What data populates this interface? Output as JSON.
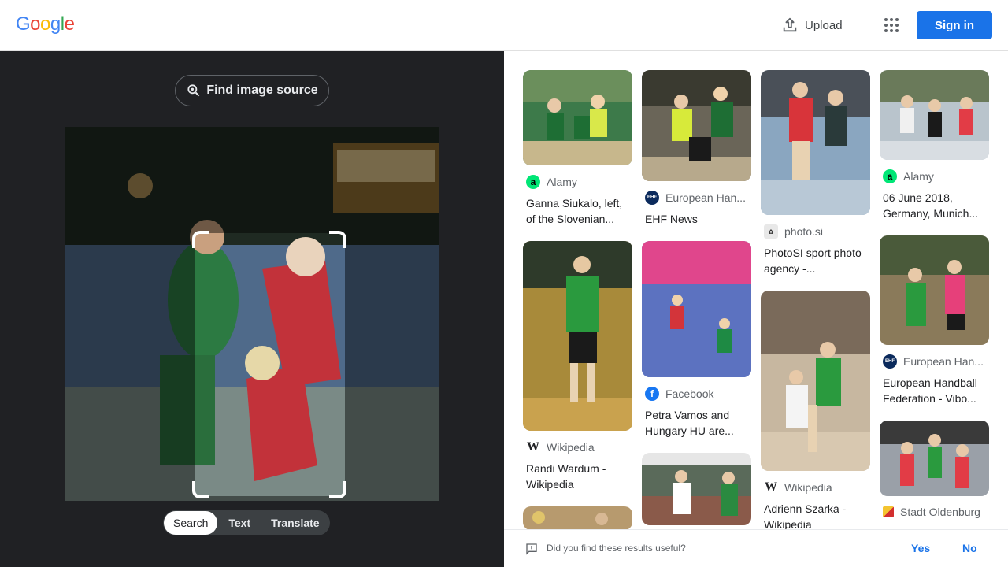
{
  "header": {
    "logo_letters": [
      "G",
      "o",
      "o",
      "g",
      "l",
      "e"
    ],
    "logo_colors": [
      "#4285f4",
      "#ea4335",
      "#fbbc05",
      "#4285f4",
      "#34a853",
      "#ea4335"
    ],
    "upload_label": "Upload",
    "signin_label": "Sign in"
  },
  "left": {
    "find_source_label": "Find image source",
    "modes": [
      "Search",
      "Text",
      "Translate"
    ],
    "active_mode": "Search"
  },
  "results": [
    {
      "source": "Alamy",
      "favicon": "a",
      "caption": "Ganna Siukalo, left, of the Slovenian..."
    },
    {
      "source": "European Han...",
      "favicon": "EHF",
      "caption": "EHF News"
    },
    {
      "source": "photo.si",
      "favicon": "photo",
      "caption": "PhotoSI sport photo agency -..."
    },
    {
      "source": "Alamy",
      "favicon": "a",
      "caption": "06 June 2018, Germany, Munich..."
    },
    {
      "source": "Wikipedia",
      "favicon": "W",
      "caption": "Randi Wardum - Wikipedia"
    },
    {
      "source": "Facebook",
      "favicon": "f",
      "caption": "Petra Vamos and Hungary HU are..."
    },
    {
      "source": "Wikipedia",
      "favicon": "W",
      "caption": "Adrienn Szarka - Wikipedia"
    },
    {
      "source": "European Han...",
      "favicon": "EHF",
      "caption": "European Handball Federation - Vibo..."
    },
    {
      "source": "Stadt Oldenburg",
      "favicon": "crest",
      "caption": ""
    }
  ],
  "feedback": {
    "question": "Did you find these results useful?",
    "yes": "Yes",
    "no": "No"
  },
  "colors": {
    "accent": "#1a73e8",
    "dark_panel": "#202124"
  }
}
